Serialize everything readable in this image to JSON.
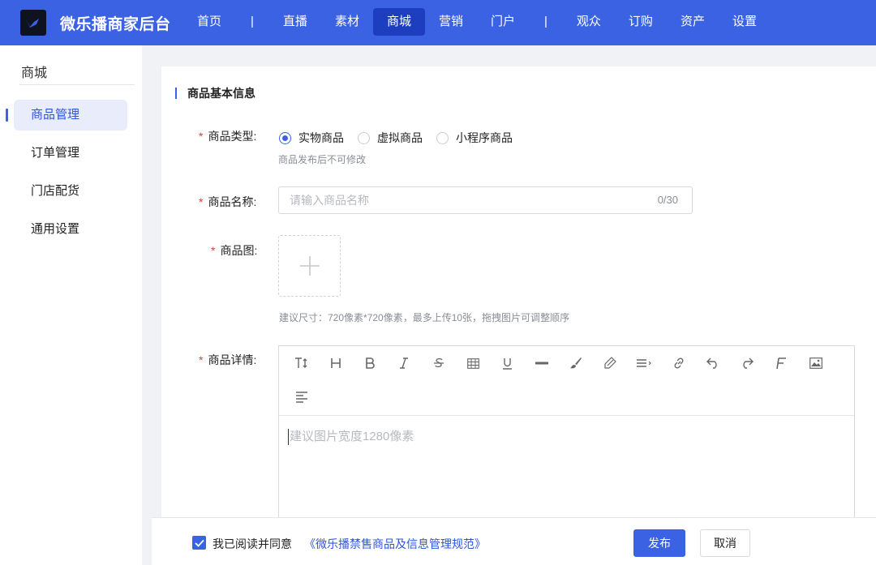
{
  "app": {
    "title": "微乐播商家后台"
  },
  "nav": {
    "items": [
      {
        "label": "首页"
      },
      {
        "label": "|"
      },
      {
        "label": "直播"
      },
      {
        "label": "素材"
      },
      {
        "label": "商城",
        "active": true
      },
      {
        "label": "营销"
      },
      {
        "label": "门户"
      },
      {
        "label": "|"
      },
      {
        "label": "观众"
      },
      {
        "label": "订购"
      },
      {
        "label": "资产"
      },
      {
        "label": "设置"
      }
    ]
  },
  "sidebar": {
    "title": "商城",
    "items": [
      {
        "label": "商品管理",
        "active": true
      },
      {
        "label": "订单管理"
      },
      {
        "label": "门店配货"
      },
      {
        "label": "通用设置"
      }
    ]
  },
  "form": {
    "section_title": "商品基本信息",
    "required_mark": "*",
    "type": {
      "label": "商品类型:",
      "options": [
        {
          "label": "实物商品",
          "selected": true
        },
        {
          "label": "虚拟商品",
          "selected": false
        },
        {
          "label": "小程序商品",
          "selected": false
        }
      ],
      "hint": "商品发布后不可修改"
    },
    "name": {
      "label": "商品名称:",
      "placeholder": "请输入商品名称",
      "value": "",
      "counter": "0/30"
    },
    "image": {
      "label": "商品图:",
      "hint": "建议尺寸：720像素*720像素，最多上传10张，拖拽图片可调整顺序"
    },
    "detail": {
      "label": "商品详情:",
      "placeholder": "建议图片宽度1280像素",
      "toolbar": [
        "text-size-icon",
        "heading-icon",
        "bold-icon",
        "italic-icon",
        "strikethrough-icon",
        "table-icon",
        "underline-icon",
        "horizontal-rule-icon",
        "brush-icon",
        "eraser-icon",
        "line-height-icon",
        "link-icon",
        "undo-icon",
        "redo-icon",
        "font-icon",
        "image-icon",
        "align-left-icon"
      ]
    }
  },
  "footer": {
    "agree_checked": true,
    "agree_text": "我已阅读并同意",
    "agree_link": "《微乐播禁售商品及信息管理规范》",
    "publish_label": "发布",
    "cancel_label": "取消"
  },
  "colors": {
    "primary": "#3b62e3",
    "primary_dark": "#1d3fbf",
    "required": "#e23b3b"
  }
}
